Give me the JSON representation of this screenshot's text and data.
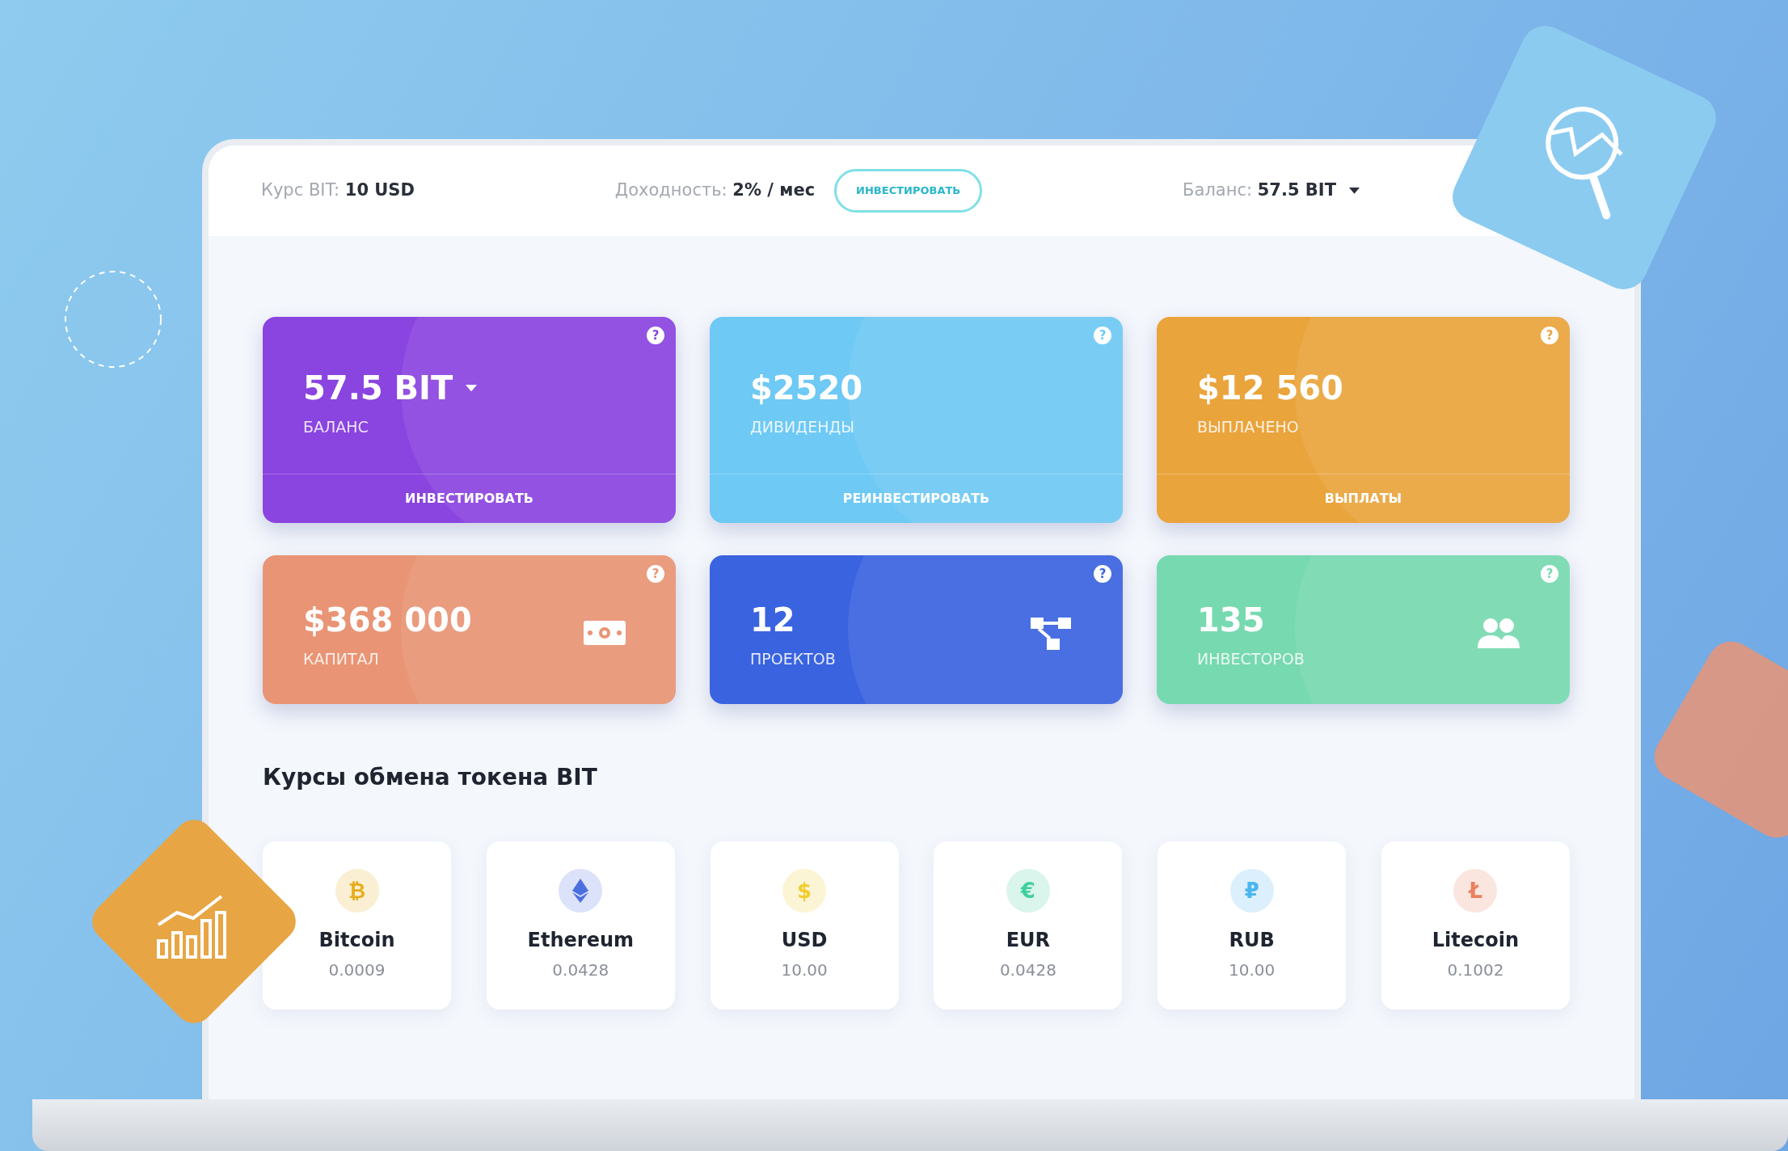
{
  "header": {
    "rate_label": "Курс BIT:",
    "rate_value": "10 USD",
    "yield_label": "Доходность:",
    "yield_value": "2% / мес",
    "invest_button": "ИНВЕСТИРОВАТЬ",
    "balance_label": "Баланс:",
    "balance_value": "57.5 BIT",
    "balance_dropdown": true
  },
  "stat_cards": [
    {
      "kind": "action",
      "value": "57.5 BIT",
      "dropdown": true,
      "label": "БАЛАНС",
      "action": "ИНВЕСТИРОВАТЬ",
      "help": "?",
      "color": "#8a44e0"
    },
    {
      "kind": "action",
      "value": "$2520",
      "dropdown": false,
      "label": "ДИВИДЕНДЫ",
      "action": "РЕИНВЕСТИРОВАТЬ",
      "help": "?",
      "color": "#6ec9f4"
    },
    {
      "kind": "action",
      "value": "$12 560",
      "dropdown": false,
      "label": "ВЫПЛАЧЕНО",
      "action": "ВЫПЛАТЫ",
      "help": "?",
      "color": "#eaa43c"
    },
    {
      "kind": "cash",
      "value": "$368 000",
      "dropdown": false,
      "label": "КАПИТАЛ",
      "help": "?",
      "color": "#e99475"
    },
    {
      "kind": "network",
      "value": "12",
      "dropdown": false,
      "label": "ПРОЕКТОВ",
      "help": "?",
      "color": "#3a63e0"
    },
    {
      "kind": "people",
      "value": "135",
      "dropdown": false,
      "label": "ИНВЕСТОРОВ",
      "help": "?",
      "color": "#77d9b0"
    }
  ],
  "rates": {
    "title": "Курсы обмена токена BIT",
    "items": [
      {
        "kind": "glyph",
        "symbol": "₿",
        "name": "Bitcoin",
        "value": "0.0009",
        "color": "#e8ad1c"
      },
      {
        "kind": "diamond",
        "name": "Ethereum",
        "value": "0.0428",
        "color": "#4c6fe0"
      },
      {
        "kind": "glyph",
        "symbol": "$",
        "name": "USD",
        "value": "10.00",
        "color": "#f2cc2c"
      },
      {
        "kind": "glyph",
        "symbol": "€",
        "name": "EUR",
        "value": "0.0428",
        "color": "#3fcf9f"
      },
      {
        "kind": "glyph",
        "symbol": "₽",
        "name": "RUB",
        "value": "10.00",
        "color": "#4ab6f2"
      },
      {
        "kind": "glyph",
        "symbol": "Ł",
        "name": "Litecoin",
        "value": "0.1002",
        "color": "#e9805f"
      }
    ]
  }
}
